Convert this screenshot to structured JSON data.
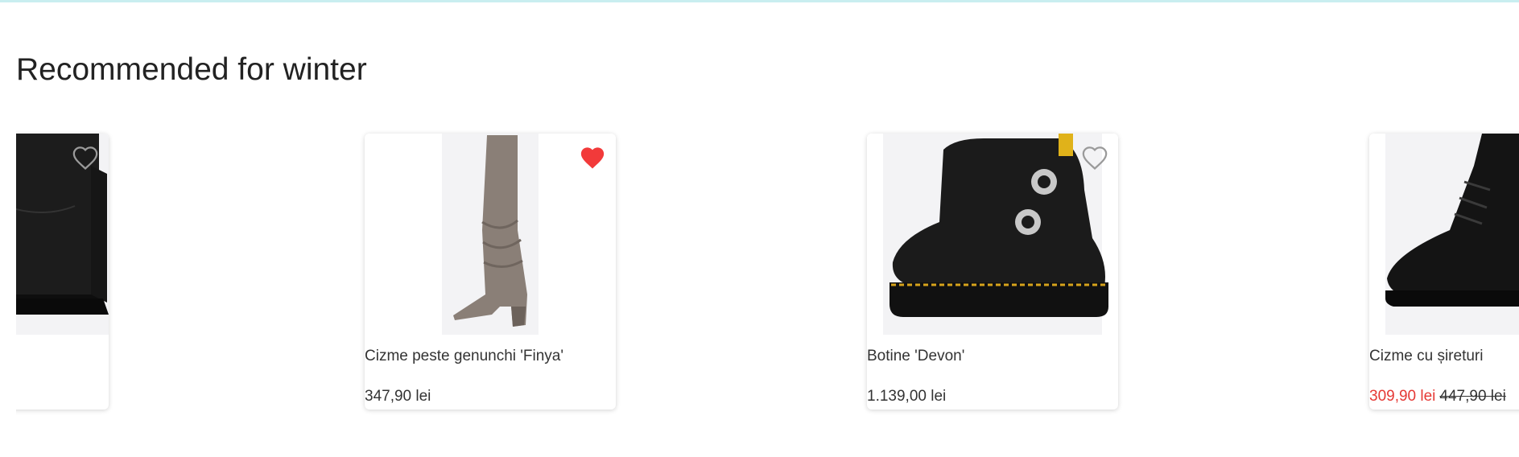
{
  "section": {
    "title": "Recommended for winter"
  },
  "products": [
    {
      "name": "",
      "price": "",
      "favorited": false,
      "image": "black-suede-winter-boot"
    },
    {
      "name": "Cizme peste genunchi 'Finya'",
      "price": "347,90 lei",
      "favorited": true,
      "image": "taupe-suede-over-knee-boot"
    },
    {
      "name": "Botine 'Devon'",
      "price": "1.139,00 lei",
      "favorited": false,
      "image": "black-leather-double-strap-boot"
    },
    {
      "name": "Cizme cu șireturi",
      "price": "309,90 lei",
      "old_price": "447,90 lei",
      "favorited": false,
      "image": "black-leather-lace-up-boot"
    }
  ],
  "colors": {
    "heart_active": "#f23a3a",
    "sale_price": "#e53935",
    "top_line": "#c9eef0"
  }
}
